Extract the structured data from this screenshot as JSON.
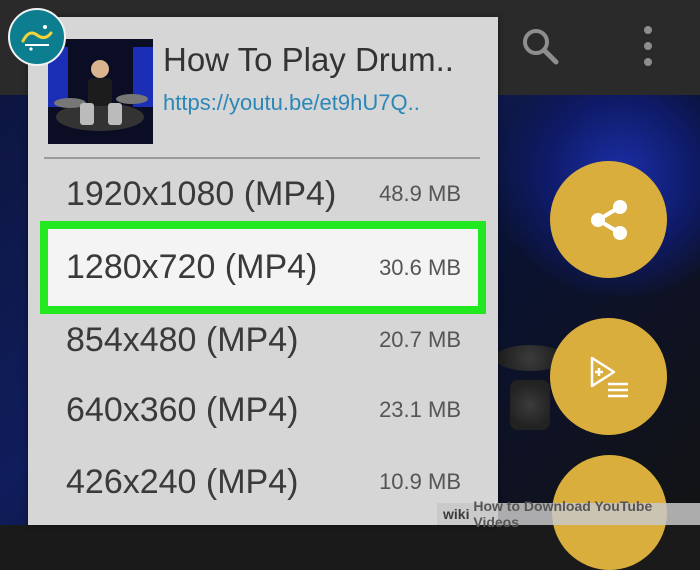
{
  "dialog": {
    "video_title": "How To Play Drum..",
    "video_link": "https://youtu.be/et9hU7Q..",
    "options": [
      {
        "resolution": "1920x1080 (MP4)",
        "size": "48.9 MB",
        "selected": false
      },
      {
        "resolution": "1280x720 (MP4)",
        "size": "30.6 MB",
        "selected": true
      },
      {
        "resolution": "854x480 (MP4)",
        "size": "20.7 MB",
        "selected": false
      },
      {
        "resolution": "640x360 (MP4)",
        "size": "23.1 MB",
        "selected": false
      },
      {
        "resolution": "426x240 (MP4)",
        "size": "10.9 MB",
        "selected": false
      }
    ]
  },
  "icons": {
    "search": "search-icon",
    "more": "more-vert-icon",
    "share": "share-icon",
    "playlist": "playlist-add-icon"
  },
  "colors": {
    "highlight": "#22e81f",
    "fab": "#d9ae3d",
    "link": "#2b87b8"
  },
  "watermark": {
    "wiki": "wiki",
    "text": "How to Download YouTube Videos"
  }
}
